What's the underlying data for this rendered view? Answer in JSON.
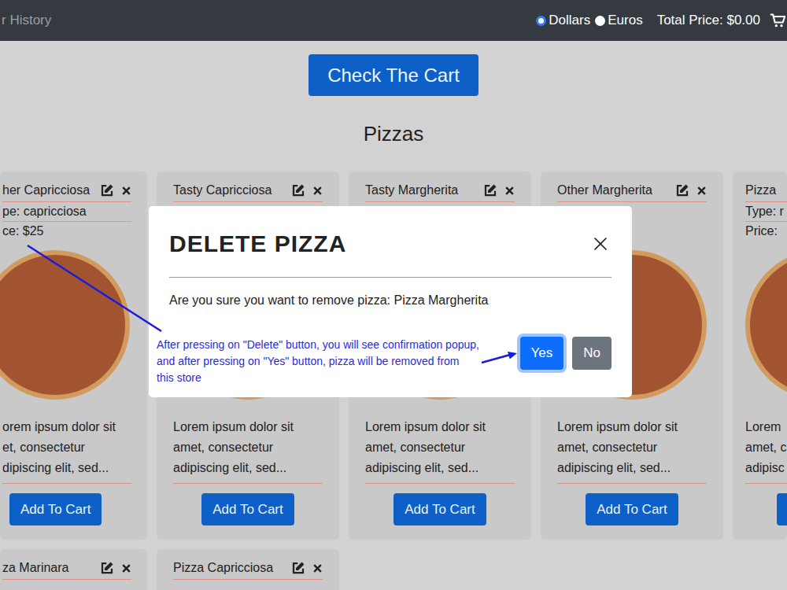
{
  "navbar": {
    "link": "r History",
    "currencies": [
      {
        "label": "Dollars",
        "selected": true
      },
      {
        "label": "Euros",
        "selected": false
      }
    ],
    "total": "Total Price: $0.00"
  },
  "cart_button": "Check The Cart",
  "heading": "Pizzas",
  "card_rows": [
    [
      {
        "title": "her Capricciosa",
        "type": "pe: capricciosa",
        "price": "ce: $25",
        "description": [
          "orem ipsum dolor sit",
          "et, consectetur",
          "dipiscing elit, sed..."
        ],
        "button": "Add To Cart"
      },
      {
        "title": "Tasty Capricciosa",
        "description": [
          "Lorem ipsum dolor sit",
          "amet, consectetur",
          "adipiscing elit, sed..."
        ],
        "button": "Add To Cart"
      },
      {
        "title": "Tasty Margherita",
        "description": [
          "Lorem ipsum dolor sit",
          "amet, consectetur",
          "adipiscing elit, sed..."
        ],
        "button": "Add To Cart"
      },
      {
        "title": "Other Margherita",
        "description": [
          "Lorem ipsum dolor sit",
          "amet, consectetur",
          "adipiscing elit, sed..."
        ],
        "button": "Add To Cart"
      },
      {
        "title": "Pizza",
        "type": "Type: r",
        "price": "Price:",
        "description": [
          "Lorem",
          "amet, c",
          "adipisc"
        ],
        "button_cut": true
      }
    ],
    [
      {
        "title": "za Marinara"
      },
      {
        "title": "Pizza Capricciosa"
      }
    ]
  ],
  "modal": {
    "title": "DELETE PIZZA",
    "message": "Are you sure you want to remove pizza: Pizza Margherita",
    "buttons": [
      {
        "label": "Yes",
        "focused": true
      },
      {
        "label": "No",
        "focused": false
      }
    ]
  },
  "annotation": "After pressing on \"Delete\" button, you will see confirmation popup, and after pressing on \"Yes\" button, pizza will be removed from this store"
}
